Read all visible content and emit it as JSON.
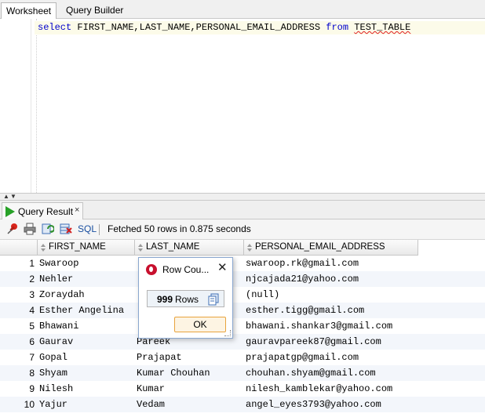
{
  "tabs": {
    "worksheet": "Worksheet",
    "query_builder": "Query Builder"
  },
  "editor": {
    "keyword_select": "select",
    "columns": "FIRST_NAME,LAST_NAME,PERSONAL_EMAIL_ADDRESS",
    "keyword_from": "from",
    "table": "TEST_TABLE"
  },
  "result_panel": {
    "tab_label": "Query Result",
    "close_glyph": "×"
  },
  "toolbar": {
    "sql_label": "SQL",
    "status": "Fetched 50 rows in 0.875 seconds"
  },
  "grid": {
    "columns": [
      "FIRST_NAME",
      "LAST_NAME",
      "PERSONAL_EMAIL_ADDRESS"
    ],
    "rows": [
      {
        "num": "1",
        "first": "Swaroop",
        "last": "",
        "email": "swaroop.rk@gmail.com"
      },
      {
        "num": "2",
        "first": "Nehler",
        "last": "",
        "email": "njcajada21@yahoo.com"
      },
      {
        "num": "3",
        "first": "Zoraydah",
        "last": "",
        "email": "(null)"
      },
      {
        "num": "4",
        "first": "Esther Angelina",
        "last": "",
        "email": "esther.tigg@gmail.com"
      },
      {
        "num": "5",
        "first": "Bhawani",
        "last": "",
        "email": "bhawani.shankar3@gmail.com"
      },
      {
        "num": "6",
        "first": "Gaurav",
        "last": "Pareek",
        "email": "gauravpareek87@gmail.com"
      },
      {
        "num": "7",
        "first": "Gopal",
        "last": "Prajapat",
        "email": "prajapatgp@gmail.com"
      },
      {
        "num": "8",
        "first": "Shyam",
        "last": "Kumar Chouhan",
        "email": "chouhan.shyam@gmail.com"
      },
      {
        "num": "9",
        "first": "Nilesh",
        "last": "Kumar",
        "email": "nilesh_kamblekar@yahoo.com"
      },
      {
        "num": "10",
        "first": "Yajur",
        "last": "Vedam",
        "email": "angel_eyes3793@yahoo.com"
      }
    ]
  },
  "dialog": {
    "title": "Row Cou...",
    "close_glyph": "✕",
    "count": "999",
    "count_label": "Rows",
    "ok_label": "OK"
  },
  "colors": {
    "keyword": "#0000cc",
    "play_icon": "#27a127",
    "ok_border": "#e8a33d",
    "alt_row": "#f3f6fb"
  }
}
